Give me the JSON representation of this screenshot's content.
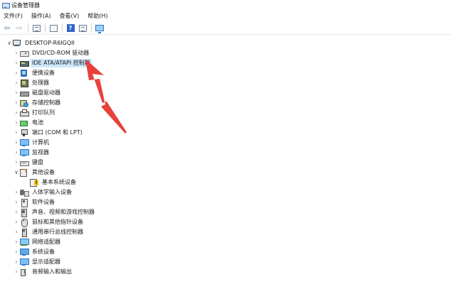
{
  "window": {
    "title": "设备管理器"
  },
  "menu": [
    {
      "label": "文件(F)"
    },
    {
      "label": "操作(A)"
    },
    {
      "label": "查看(V)"
    },
    {
      "label": "帮助(H)"
    }
  ],
  "toolbar": {
    "back_glyph": "⇦",
    "forward_glyph": "⇨",
    "help_glyph": "?"
  },
  "tree": {
    "root": {
      "label": "DESKTOP-R6IGQII",
      "caret": "∨"
    },
    "items": [
      {
        "label": "DVD/CD-ROM 驱动器",
        "icon": "drive-icon",
        "caret": "›"
      },
      {
        "label": "IDE ATA/ATAPI 控制器",
        "icon": "ide-controller-icon",
        "caret": "›",
        "selected": true
      },
      {
        "label": "便携设备",
        "icon": "portable-device-icon",
        "caret": "›"
      },
      {
        "label": "处理器",
        "icon": "processor-icon",
        "caret": "›"
      },
      {
        "label": "磁盘驱动器",
        "icon": "disk-drive-icon",
        "caret": "›"
      },
      {
        "label": "存储控制器",
        "icon": "storage-controller-icon",
        "caret": "›"
      },
      {
        "label": "打印队列",
        "icon": "printer-icon",
        "caret": "›"
      },
      {
        "label": "电池",
        "icon": "battery-icon",
        "caret": "›"
      },
      {
        "label": "端口 (COM 和 LPT)",
        "icon": "port-icon",
        "caret": "›"
      },
      {
        "label": "计算机",
        "icon": "computer-icon",
        "caret": "›"
      },
      {
        "label": "监视器",
        "icon": "monitor-icon",
        "caret": "›"
      },
      {
        "label": "键盘",
        "icon": "keyboard-icon",
        "caret": "›"
      },
      {
        "label": "其他设备",
        "icon": "other-devices-icon",
        "caret": "∨"
      },
      {
        "label": "基本系统设备",
        "icon": "warning-device-icon",
        "caret": "",
        "child": true
      },
      {
        "label": "人体学输入设备",
        "icon": "hid-icon",
        "caret": "›"
      },
      {
        "label": "软件设备",
        "icon": "software-device-icon",
        "caret": "›"
      },
      {
        "label": "声音、视频和游戏控制器",
        "icon": "sound-controller-icon",
        "caret": "›"
      },
      {
        "label": "鼠标和其他指针设备",
        "icon": "mouse-icon",
        "caret": "›"
      },
      {
        "label": "通用串行总线控制器",
        "icon": "usb-icon",
        "caret": "›"
      },
      {
        "label": "网络适配器",
        "icon": "network-adapter-icon",
        "caret": "›"
      },
      {
        "label": "系统设备",
        "icon": "system-device-icon",
        "caret": "›"
      },
      {
        "label": "显示适配器",
        "icon": "display-adapter-icon",
        "caret": "›"
      },
      {
        "label": "音频输入和输出",
        "icon": "audio-io-icon",
        "caret": "›"
      }
    ]
  },
  "colors": {
    "selection": "#cce8ff",
    "annotation_arrow": "#e8413a"
  }
}
